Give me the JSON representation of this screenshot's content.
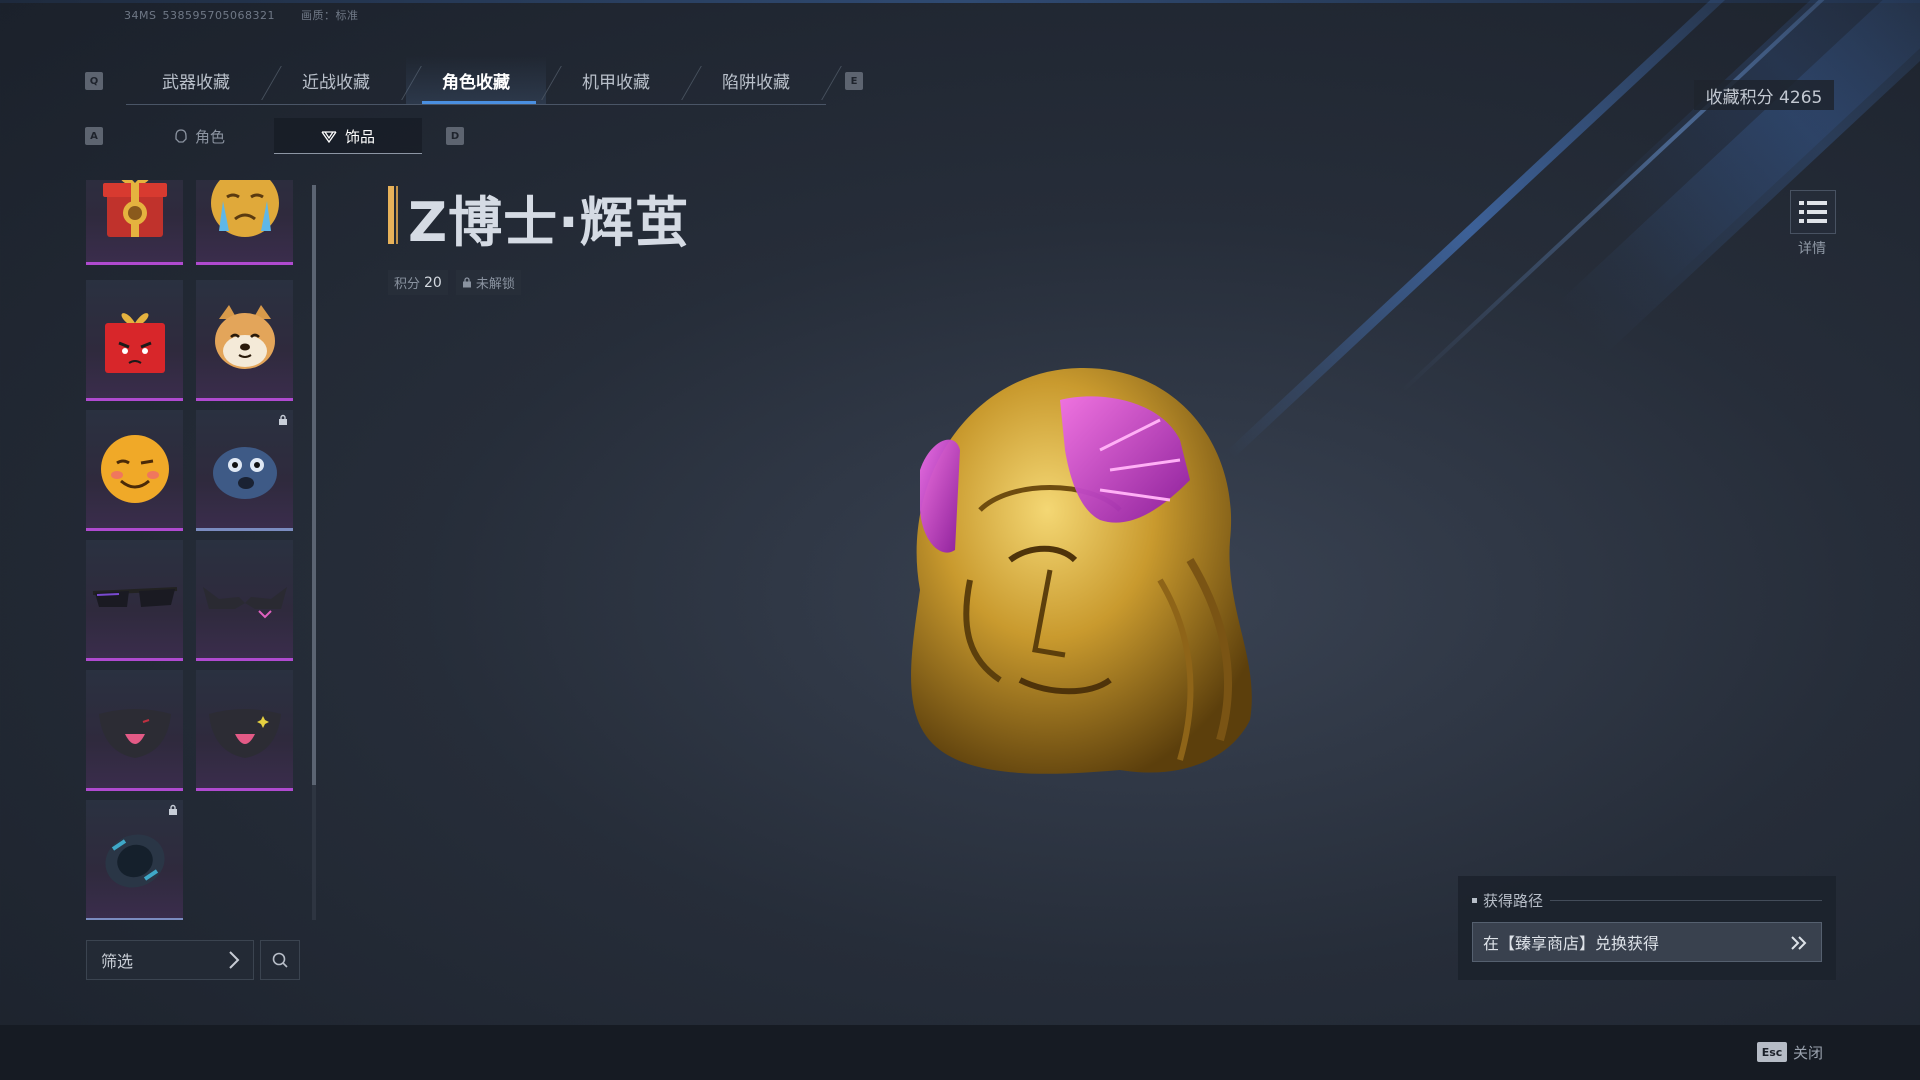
{
  "system": {
    "ping": "34MS",
    "uid": "538595705068321",
    "quality": "画质：标准"
  },
  "keys": {
    "prev_tab": "Q",
    "next_tab": "E",
    "prev_sub": "A",
    "next_sub": "D",
    "esc": "Esc"
  },
  "tabs": [
    {
      "label": "武器收藏",
      "active": false
    },
    {
      "label": "近战收藏",
      "active": false
    },
    {
      "label": "角色收藏",
      "active": true
    },
    {
      "label": "机甲收藏",
      "active": false
    },
    {
      "label": "陷阱收藏",
      "active": false
    }
  ],
  "subtabs": [
    {
      "label": "角色",
      "icon": "helmet-icon",
      "active": false
    },
    {
      "label": "饰品",
      "icon": "accessory-icon",
      "active": true
    }
  ],
  "collection_score": "收藏积分 4265",
  "item": {
    "name": "Z博士·辉茧",
    "score_label": "积分",
    "score_value": "20",
    "lock_status": "未解锁"
  },
  "detail_label": "详情",
  "acquisition": {
    "title": "获得路径",
    "route": "在【臻享商店】兑换获得"
  },
  "filter_label": "筛选",
  "close_label": "关闭",
  "grid_items": [
    {
      "icon": "gift-box-gold-icon",
      "locked": false
    },
    {
      "icon": "crying-emoji-icon",
      "locked": false
    },
    {
      "icon": "angry-gift-box-icon",
      "locked": false
    },
    {
      "icon": "shiba-dog-icon",
      "locked": false
    },
    {
      "icon": "blushing-emoji-icon",
      "locked": false
    },
    {
      "icon": "scared-blob-icon",
      "locked": true
    },
    {
      "icon": "sunglasses-icon",
      "locked": false
    },
    {
      "icon": "cat-eye-glasses-icon",
      "locked": false
    },
    {
      "icon": "mask-tongue-icon",
      "locked": false
    },
    {
      "icon": "mask-sparkle-icon",
      "locked": false
    },
    {
      "icon": "wrist-gear-icon",
      "locked": true
    }
  ],
  "colors": {
    "accent": "#4a8fe0",
    "rarity": "#b04ad0",
    "title_bar": "#e7b25a",
    "gold": "#c9a13a",
    "crystal": "#c24ad6"
  }
}
